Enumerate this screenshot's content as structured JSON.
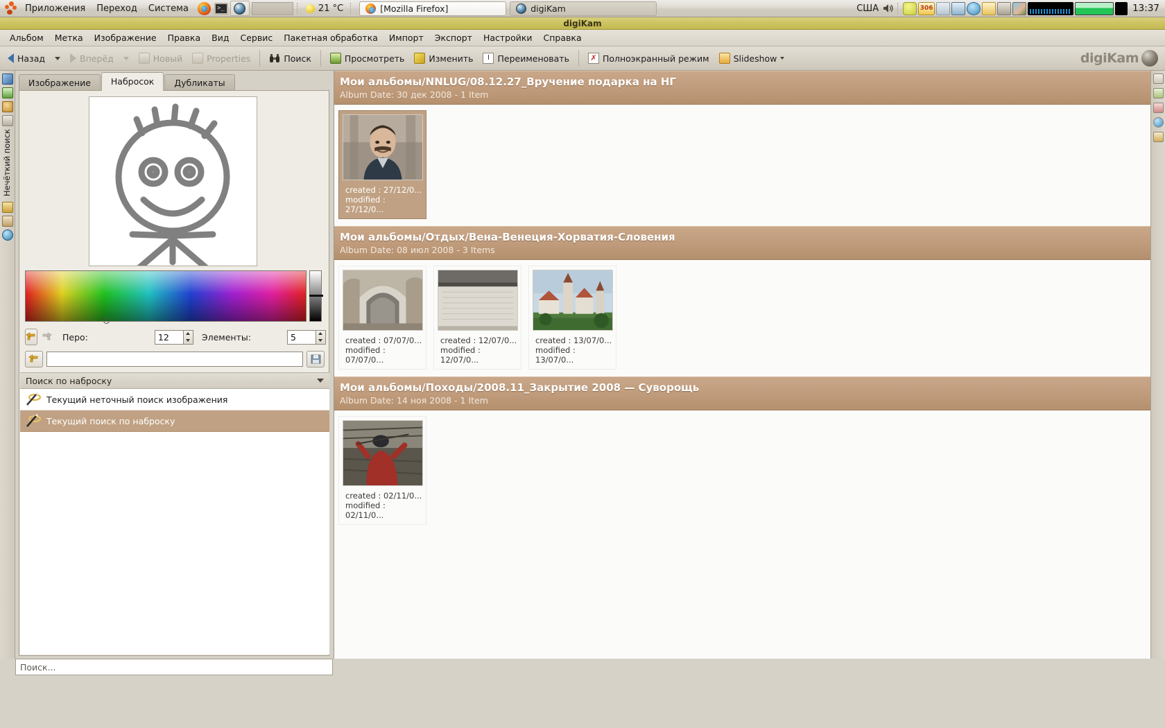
{
  "panel": {
    "menus": [
      "Приложения",
      "Переход",
      "Система"
    ],
    "launchers": [
      "firefox-icon",
      "terminal-icon",
      "digikam-icon"
    ],
    "temperature": "21 °C",
    "windows": [
      {
        "label": "[Mozilla Firefox]",
        "icon": "firefox-icon",
        "active": true
      },
      {
        "label": "digiKam",
        "icon": "digikam-icon",
        "active": false
      }
    ],
    "keyboard_layout": "США",
    "tray_icons": [
      "volume-icon",
      "battery-icon",
      "update-306-icon",
      "glasses-icon",
      "network-icon",
      "calendar-lock-icon",
      "pidgin-icon",
      "folder-icon",
      "monitor-icon",
      "photo-icon",
      "audio-meter-icon",
      "green-meter-icon"
    ],
    "tray_badge": "306",
    "clock": "13:37"
  },
  "window": {
    "title": "digiKam"
  },
  "menubar": {
    "items": [
      "Альбом",
      "Метка",
      "Изображение",
      "Правка",
      "Вид",
      "Сервис",
      "Пакетная обработка",
      "Импорт",
      "Экспорт",
      "Настройки",
      "Справка"
    ]
  },
  "toolbar": {
    "back": "Назад",
    "forward": "Вперёд",
    "new": "Новый",
    "properties": "Properties",
    "search": "Поиск",
    "view": "Просмотреть",
    "edit": "Изменить",
    "rename": "Переименовать",
    "fullscreen": "Полноэкранный режим",
    "slideshow": "Slideshow",
    "brand": "digiKam"
  },
  "vstrip": {
    "label": "Нечёткий поиск",
    "icons": [
      "albums-icon",
      "calendar-icon",
      "tags-icon",
      "timeline-icon",
      "searches-icon",
      "fuzzy-search-icon",
      "map-icon"
    ]
  },
  "left": {
    "tabs": [
      {
        "label": "Изображение",
        "selected": false
      },
      {
        "label": "Набросок",
        "selected": true
      },
      {
        "label": "Дубликаты",
        "selected": false
      }
    ],
    "pen_label": "Перо:",
    "pen_value": "12",
    "items_label": "Элементы:",
    "items_value": "5",
    "name_value": "",
    "undo_icon": "undo-icon",
    "redo_icon": "redo-icon",
    "reset_icon": "reset-icon",
    "save_icon": "save-icon",
    "group_header": "Поиск по наброску",
    "results": [
      {
        "label": "Текущий неточный поиск изображения",
        "selected": false
      },
      {
        "label": "Текущий поиск по наброску",
        "selected": true
      }
    ],
    "status": "Поиск..."
  },
  "main": {
    "albums": [
      {
        "title": "Мои альбомы/NNLUG/08.12.27_Вручение подарка на НГ",
        "subtitle": "Album Date: 30 дек 2008 - 1 Item",
        "items": [
          {
            "created": "created : 27/12/0...",
            "modified": "modified : 27/12/0...",
            "selected": true,
            "kind": "portrait-man"
          }
        ]
      },
      {
        "title": "Мои альбомы/Отдых/Вена-Венеция-Хорватия-Словения",
        "subtitle": "Album Date: 08 июл 2008 - 3 Items",
        "items": [
          {
            "created": "created : 07/07/0...",
            "modified": "modified : 07/07/0...",
            "selected": false,
            "kind": "arch-stone"
          },
          {
            "created": "created : 12/07/0...",
            "modified": "modified : 12/07/0...",
            "selected": false,
            "kind": "gray-wall"
          },
          {
            "created": "created : 13/07/0...",
            "modified": "modified : 13/07/0...",
            "selected": false,
            "kind": "church-towers"
          }
        ]
      },
      {
        "title": "Мои альбомы/Походы/2008.11_Закрытие 2008 — Суворощь",
        "subtitle": "Album Date: 14 ноя 2008 - 1 Item",
        "items": [
          {
            "created": "created : 02/11/0...",
            "modified": "modified : 02/11/0...",
            "selected": false,
            "kind": "hiker-red"
          }
        ]
      }
    ]
  },
  "colors": {
    "album_header": "#bf9b7b",
    "selection": "#c0a183",
    "titlebar": "#cfc566",
    "panel_bg": "#d6d2c8"
  }
}
